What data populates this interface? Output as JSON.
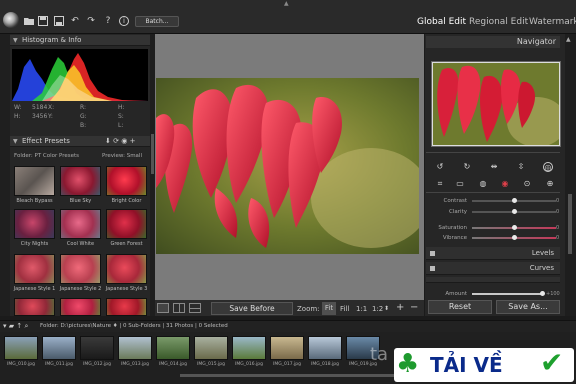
{
  "toolbar": {
    "batch_label": "Batch...",
    "icons": [
      "open-folder-icon",
      "save-icon",
      "save-as-icon",
      "undo-icon",
      "redo-icon",
      "help-icon",
      "info-icon"
    ],
    "help_glyph": "?",
    "info_glyph": "i"
  },
  "modes": {
    "global": "Global Edit",
    "regional": "Regional Edit",
    "watermark": "Watermark"
  },
  "histogram": {
    "title": "Histogram & Info",
    "w_label": "W:",
    "w_value": "5184",
    "h_label": "H:",
    "h_value": "3456",
    "x_label": "X:",
    "y_label": "Y:",
    "r_label": "R:",
    "g_label": "G:",
    "b_label": "B:",
    "h2_label": "H:",
    "s_label": "S:",
    "l_label": "L:",
    "dash": "-"
  },
  "presets": {
    "title": "Effect Presets",
    "folder_label": "Folder: PT Color Presets",
    "preview_label": "Preview: Small",
    "items": [
      {
        "label": "Bleach Bypass"
      },
      {
        "label": "Blue Sky"
      },
      {
        "label": "Bright Color"
      },
      {
        "label": "City Nights"
      },
      {
        "label": "Cool White"
      },
      {
        "label": "Green Forest"
      },
      {
        "label": "Japanese Style 1"
      },
      {
        "label": "Japanese Style 2"
      },
      {
        "label": "Japanese Style 3"
      }
    ]
  },
  "view": {
    "save_before": "Save Before",
    "zoom_label": "Zoom:",
    "fit": "Fit",
    "fill": "Fill",
    "one_to_one": "1:1",
    "one_to_two": "1:2",
    "plus": "+",
    "minus": "−"
  },
  "navigator": {
    "title": "Navigator"
  },
  "adjust": {
    "contrast": {
      "label": "Contrast",
      "value": "0",
      "level": 0.5
    },
    "clarity": {
      "label": "Clarity",
      "value": "0",
      "level": 0.5
    },
    "saturation": {
      "label": "Saturation",
      "value": "0",
      "level": 0.5
    },
    "vibrance": {
      "label": "Vibrance",
      "value": "0",
      "level": 0.5
    }
  },
  "sections": {
    "levels": "Levels",
    "curves": "Curves"
  },
  "amount": {
    "label": "Amount",
    "value": "+100",
    "level": 1.0
  },
  "buttons": {
    "reset": "Reset",
    "save_as": "Save As..."
  },
  "filmstrip": {
    "path": "Folder: D:\\pictures\\Nature ♦ | 0 Sub-Folders | 31 Photos | 0 Selected",
    "files": [
      "IMG_010.jpg",
      "IMG_011.jpg",
      "IMG_012.jpg",
      "IMG_013.jpg",
      "IMG_014.jpg",
      "IMG_015.jpg",
      "IMG_016.jpg",
      "IMG_017.jpg",
      "IMG_018.jpg",
      "IMG_019.jpg"
    ]
  },
  "watermark_badge": {
    "site": "ta",
    "text": "TẢI VỀ"
  },
  "colors": {
    "accent": "#cf1e3a",
    "panel": "#262626",
    "canvas": "#7b7b7b"
  }
}
